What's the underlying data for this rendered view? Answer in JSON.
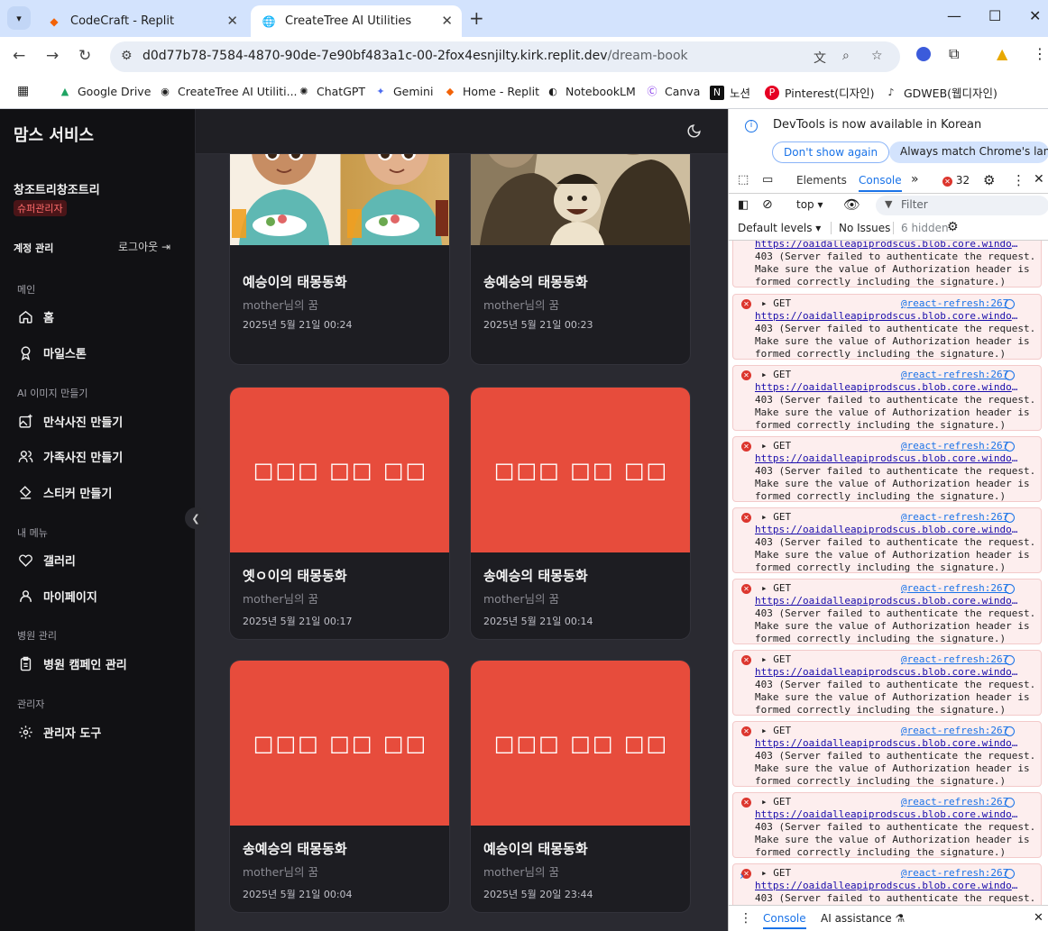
{
  "browser": {
    "tabs": [
      {
        "title": "CodeCraft - Replit",
        "active": false
      },
      {
        "title": "CreateTree AI Utilities",
        "active": true
      }
    ],
    "url_host": "d0d77b78-7584-4870-90de-7e90bf483a1c-00-2fox4esnjilty.kirk.replit.dev",
    "url_path": "/dream-book",
    "bookmarks": [
      "Google Drive",
      "CreateTree AI Utiliti...",
      "ChatGPT",
      "Gemini",
      "Home - Replit",
      "NotebookLM",
      "Canva",
      "노션",
      "Pinterest(디자인)",
      "GDWEB(웹디자인)"
    ]
  },
  "sidebar": {
    "brand": "맘스 서비스",
    "user_name": "창조트리창조트리",
    "role_badge": "슈퍼관리자",
    "account_label": "계정 관리",
    "logout_label": "로그아웃",
    "sections": {
      "menu": "메인",
      "ai": "AI 이미지 만들기",
      "my": "내 메뉴",
      "hospital": "병원 관리",
      "admin": "관리자"
    },
    "items": {
      "home": "홈",
      "milestone": "마일스톤",
      "maternity": "만삭사진 만들기",
      "family": "가족사진 만들기",
      "sticker": "스티커 만들기",
      "gallery": "갤러리",
      "mypage": "마이페이지",
      "campaign": "병원 캠페인 관리",
      "admintools": "관리자 도구"
    }
  },
  "cards": [
    {
      "title": "예승이의 태몽동화",
      "sub": "mother님의 꿈",
      "date": "2025년 5월 21일 00:24"
    },
    {
      "title": "송예승의 태몽동화",
      "sub": "mother님의 꿈",
      "date": "2025년 5월 21일 00:23"
    },
    {
      "title": "옛ㅇ이의 태몽동화",
      "sub": "mother님의 꿈",
      "date": "2025년 5월 21일 00:17",
      "placeholder": "□□□ □□ □□"
    },
    {
      "title": "송예승의 태몽동화",
      "sub": "mother님의 꿈",
      "date": "2025년 5월 21일 00:14",
      "placeholder": "□□□ □□ □□"
    },
    {
      "title": "송예승의 태몽동화",
      "sub": "mother님의 꿈",
      "date": "2025년 5월 21일 00:04",
      "placeholder": "□□□ □□ □□"
    },
    {
      "title": "예승이의 태몽동화",
      "sub": "mother님의 꿈",
      "date": "2025년 5월 20일 23:44",
      "placeholder": "□□□ □□ □□"
    }
  ],
  "devtools": {
    "info_message": "DevTools is now available in Korean",
    "dont_show": "Don't show again",
    "always_match": "Always match Chrome's langua",
    "tab_elements": "Elements",
    "tab_console": "Console",
    "error_count": "32",
    "context": "top",
    "filter_placeholder": "Filter",
    "levels": "Default levels",
    "issues": "No Issues",
    "hidden": "6 hidden",
    "log_get": "GET",
    "log_source": "@react-refresh:267",
    "log_url": "https://oaidalleapiprodscus.blob.core.windows.net",
    "log_body": "403 (Server failed to authenticate the request.\nMake sure the value of Authorization header is\nformed correctly including the signature.)",
    "bottom_console": "Console",
    "bottom_ai": "AI assistance"
  },
  "colors": {
    "sidebar_bg": "#111114",
    "main_bg": "#2a2a31",
    "card_bg": "#1d1d22",
    "error_card": "#e74c3c",
    "badge_text": "#ff6b6b",
    "console_error_bg": "#fdeeee"
  }
}
